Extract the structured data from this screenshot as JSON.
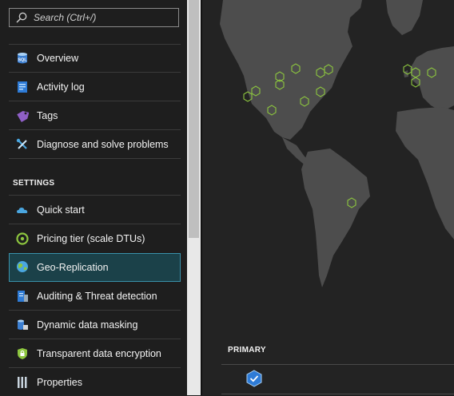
{
  "search": {
    "placeholder": "Search (Ctrl+/)"
  },
  "nav": {
    "items": [
      {
        "label": "Overview",
        "icon": "sql-database-icon"
      },
      {
        "label": "Activity log",
        "icon": "activity-log-icon"
      },
      {
        "label": "Tags",
        "icon": "tag-icon"
      },
      {
        "label": "Diagnose and solve problems",
        "icon": "wrench-icon"
      }
    ]
  },
  "settings": {
    "header": "SETTINGS",
    "items": [
      {
        "label": "Quick start",
        "icon": "cloud-icon"
      },
      {
        "label": "Pricing tier (scale DTUs)",
        "icon": "gauge-icon"
      },
      {
        "label": "Geo-Replication",
        "icon": "globe-icon",
        "selected": true
      },
      {
        "label": "Auditing & Threat detection",
        "icon": "audit-icon"
      },
      {
        "label": "Dynamic data masking",
        "icon": "data-masking-icon"
      },
      {
        "label": "Transparent data encryption",
        "icon": "lock-shield-icon"
      },
      {
        "label": "Properties",
        "icon": "properties-icon"
      }
    ]
  },
  "replication": {
    "primary_header": "PRIMARY"
  },
  "colors": {
    "accent": "#3a91aa",
    "selected_bg": "#1b4149",
    "region_marker": "#8dc63f",
    "land": "#4d4d4d"
  }
}
